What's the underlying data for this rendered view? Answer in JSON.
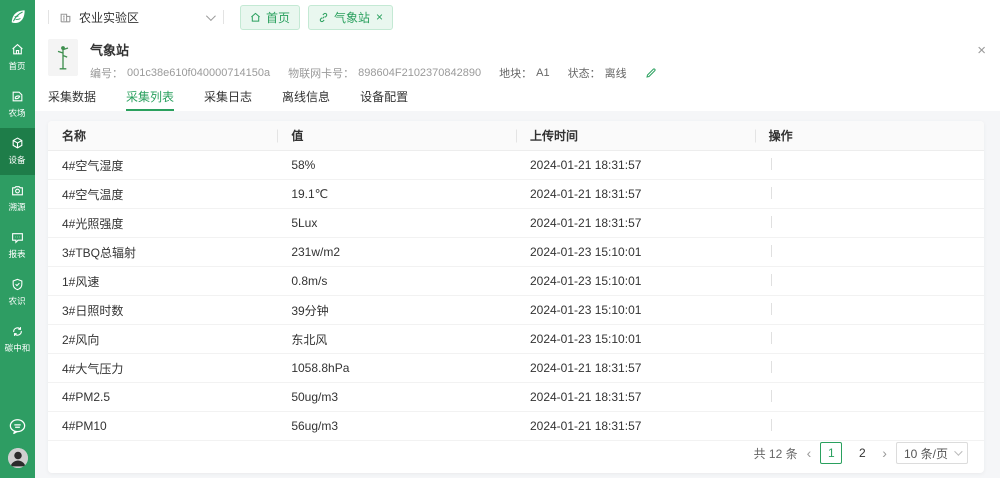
{
  "sidebar": {
    "items": [
      {
        "label": "首页",
        "icon": "home-icon",
        "active": false
      },
      {
        "label": "农场",
        "icon": "farm-icon",
        "active": false
      },
      {
        "label": "设备",
        "icon": "device-icon",
        "active": true
      },
      {
        "label": "溯源",
        "icon": "trace-camera-icon",
        "active": false
      },
      {
        "label": "报表",
        "icon": "report-icon",
        "active": false
      },
      {
        "label": "农识",
        "icon": "knowledge-shield-icon",
        "active": false
      },
      {
        "label": "碳中和",
        "icon": "carbon-cycle-icon",
        "active": false
      }
    ]
  },
  "topbar": {
    "workspace": "农业实验区",
    "tabs": [
      {
        "label": "首页",
        "closable": false
      },
      {
        "label": "气象站",
        "closable": true
      }
    ]
  },
  "device": {
    "title": "气象站",
    "serial_label": "编号：",
    "serial": "001c38e610f040000714150a",
    "iot_label": "物联网卡号：",
    "iot": "898604F2102370842890",
    "plot_label": "地块：",
    "plot": "A1",
    "status_label": "状态：",
    "status": "离线"
  },
  "tabs": {
    "items": [
      "采集数据",
      "采集列表",
      "采集日志",
      "离线信息",
      "设备配置"
    ],
    "active": "采集列表"
  },
  "table": {
    "columns": [
      "名称",
      "值",
      "上传时间",
      "操作"
    ],
    "rows": [
      {
        "name": "4#空气湿度",
        "value": "58%",
        "time": "2024-01-21 18:31:57"
      },
      {
        "name": "4#空气温度",
        "value": "19.1℃",
        "time": "2024-01-21 18:31:57"
      },
      {
        "name": "4#光照强度",
        "value": "5Lux",
        "time": "2024-01-21 18:31:57"
      },
      {
        "name": "3#TBQ总辐射",
        "value": "231w/m2",
        "time": "2024-01-23 15:10:01"
      },
      {
        "name": "1#风速",
        "value": "0.8m/s",
        "time": "2024-01-23 15:10:01"
      },
      {
        "name": "3#日照时数",
        "value": "39分钟",
        "time": "2024-01-23 15:10:01"
      },
      {
        "name": "2#风向",
        "value": "东北风",
        "time": "2024-01-23 15:10:01"
      },
      {
        "name": "4#大气压力",
        "value": "1058.8hPa",
        "time": "2024-01-21 18:31:57"
      },
      {
        "name": "4#PM2.5",
        "value": "50ug/m3",
        "time": "2024-01-21 18:31:57"
      },
      {
        "name": "4#PM10",
        "value": "56ug/m3",
        "time": "2024-01-21 18:31:57"
      }
    ]
  },
  "pagination": {
    "total": "共 12 条",
    "pages": [
      "1",
      "2"
    ],
    "active_page": "1",
    "page_size": "10 条/页"
  },
  "icons": {
    "close": "×",
    "prev": "‹",
    "next": "›"
  },
  "colors": {
    "brand_green": "#2e9d63",
    "brand_green_dark": "#1e7d49",
    "accent": "#2aa05e"
  }
}
